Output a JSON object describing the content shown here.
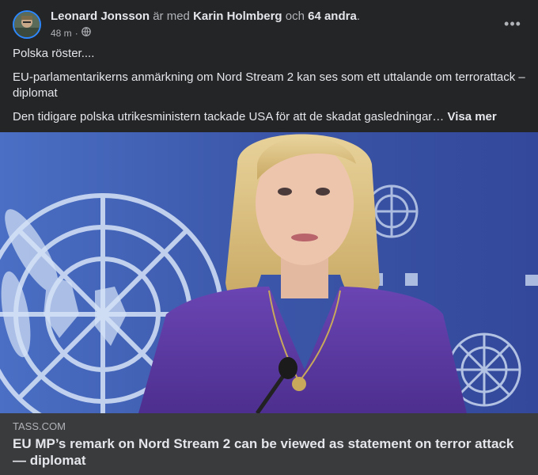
{
  "post": {
    "author": "Leonard Jonsson",
    "with_text": "är med",
    "tagged": "Karin Holmberg",
    "and_text": "och",
    "others": "64 andra",
    "period": ".",
    "time": "48 m",
    "dot": "·",
    "privacy_icon": "globe-icon",
    "more_icon": "more-options-icon",
    "more_glyph": "•••",
    "line1": "Polska röster....",
    "line2": "EU-parlamentarikerns anmärkning om Nord Stream 2 kan ses som ett uttalande om terrorattack – diplomat",
    "line3": "Den tidigare polska utrikesministern tackade USA för att de skadat gasledningar…",
    "see_more": "Visa mer"
  },
  "link_preview": {
    "domain": "TASS.COM",
    "title": "EU MP’s remark on Nord Stream 2 can be viewed as statement on terror attack — diplomat"
  },
  "colors": {
    "background": "#242526",
    "link_preview_bg": "#3a3b3c",
    "photo_blue": "#3f57a7",
    "dress_purple": "#5a3aa0",
    "avatar_ring": "#2d88ff"
  }
}
